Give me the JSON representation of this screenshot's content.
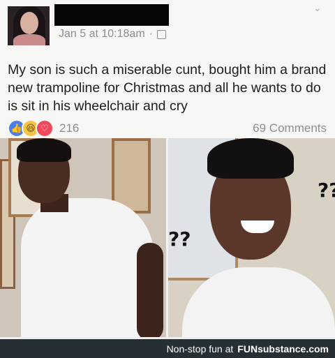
{
  "post": {
    "timestamp": "Jan 5 at 10:18am",
    "separator": "·",
    "body": "My son is such a miserable cunt, bought him a brand new trampoline for Christmas and all he wants to do is sit in his wheelchair and cry",
    "reaction_count": "216",
    "comments": "69 Comments",
    "icons": [
      "like-icon",
      "haha-icon",
      "love-icon",
      "globe-icon",
      "chevron-down-icon"
    ]
  },
  "images": {
    "left_caption": "",
    "right_marks_top": "??",
    "right_marks_left": "??"
  },
  "footer": {
    "tagline": "Non-stop fun at",
    "brand": "FUNsubstance.com"
  },
  "colors": {
    "like": "#4d7fe3",
    "haha": "#f6c544",
    "love": "#f0485a",
    "footer_bg": "#262f33"
  }
}
